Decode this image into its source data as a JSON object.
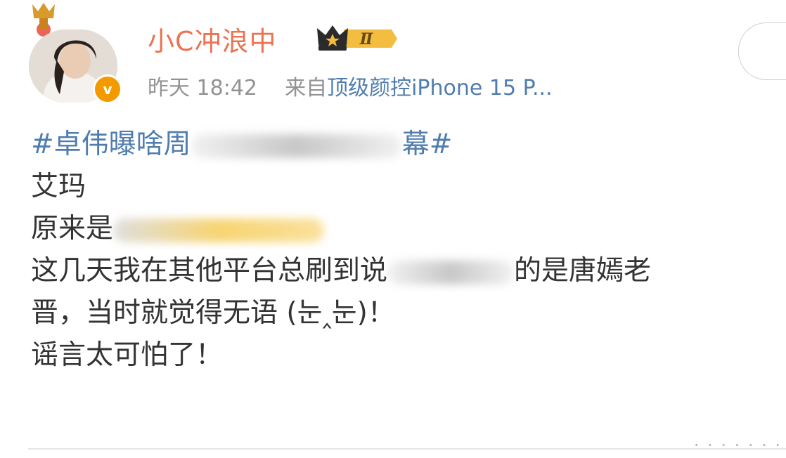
{
  "post": {
    "username": "小C冲浪中",
    "vip_level": "Ⅱ",
    "verified_mark": "v",
    "time": "昨天 18:42",
    "source_prefix": "来自",
    "source": "顶级颜控iPhone 15 P...",
    "content": {
      "hashtag_start": "#卓伟曝啥周",
      "hashtag_end": "幕#",
      "line2": "艾玛",
      "line3": "原来是",
      "line4_start": "这几天我在其他平台总刷到说",
      "line4_end": "的是唐嫣老",
      "line5": "晋，当时就觉得无语 (눈‸눈)！",
      "line6": "谣言太可怕了！"
    }
  },
  "colors": {
    "username": "#eb7350",
    "link": "#507daf",
    "meta": "#939393",
    "text": "#333333",
    "badge": "#f39a00"
  },
  "icons": {
    "avatar_badge": "verified-v-icon",
    "vip": "crown-vip-icon",
    "decoration": "trophy-crown-icon"
  }
}
